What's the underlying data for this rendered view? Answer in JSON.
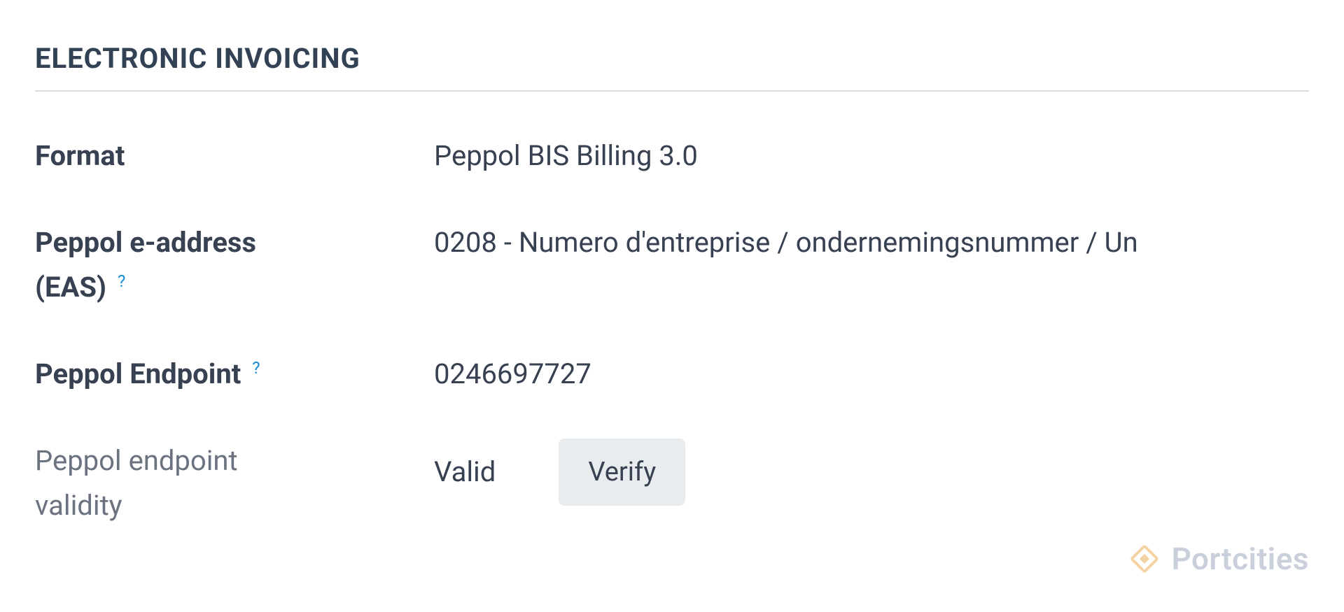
{
  "section": {
    "title": "ELECTRONIC INVOICING"
  },
  "fields": {
    "format": {
      "label": "Format",
      "value": "Peppol BIS Billing 3.0"
    },
    "eaddress": {
      "label_line1": "Peppol e-address",
      "label_line2": "(EAS)",
      "help": "?",
      "value": "0208 - Numero d'entreprise / ondernemingsnummer / Un"
    },
    "endpoint": {
      "label": "Peppol Endpoint",
      "help": "?",
      "value": "0246697727"
    },
    "validity": {
      "label_line1": "Peppol endpoint",
      "label_line2": "validity",
      "value": "Valid",
      "button": "Verify"
    }
  },
  "watermark": {
    "text": "Portcities"
  }
}
